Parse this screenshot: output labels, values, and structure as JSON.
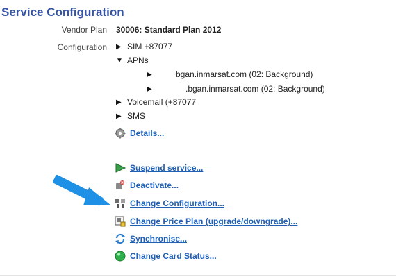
{
  "section_title": "Service Configuration",
  "vendor_plan": {
    "label": "Vendor Plan",
    "value": "30006: Standard Plan 2012"
  },
  "configuration": {
    "label": "Configuration",
    "sim": "SIM +87077",
    "apns": "APNs",
    "apn_1": "bgan.inmarsat.com (02: Background)",
    "apn_2": ".bgan.inmarsat.com (02: Background)",
    "voicemail": "Voicemail (+87077",
    "sms": "SMS"
  },
  "actions": {
    "details": "Details...",
    "suspend": "Suspend service...",
    "deactivate": "Deactivate...",
    "change_configuration": "Change Configuration...",
    "change_price_plan": "Change Price Plan (upgrade/downgrade)...",
    "synchronise": "Synchronise...",
    "change_card_status": "Change Card Status..."
  },
  "colors": {
    "title": "#3554a6",
    "link": "#1f5fb4",
    "arrow": "#1e90e6"
  },
  "icons": {
    "details": "gear-icon",
    "suspend": "play-icon",
    "deactivate": "deactivate-icon",
    "change_configuration": "configuration-icon",
    "change_price_plan": "price-plan-icon",
    "synchronise": "sync-icon",
    "change_card_status": "status-icon",
    "pointer": "blue-arrow-icon"
  }
}
